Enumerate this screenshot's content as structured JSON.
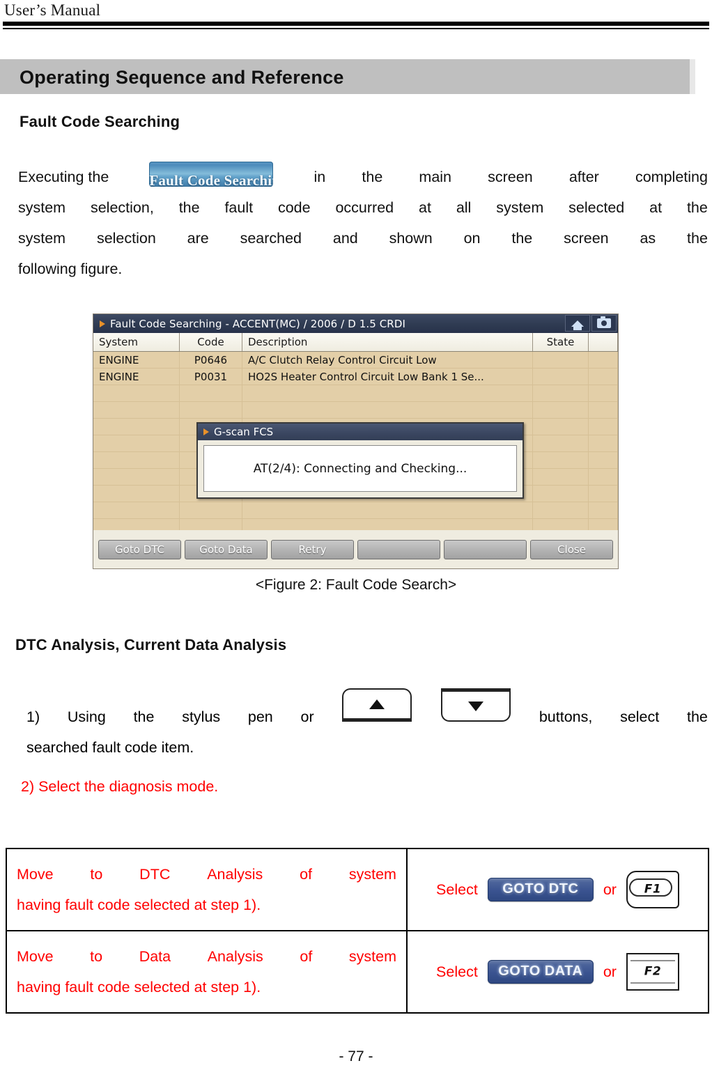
{
  "header": {
    "running_head": "User’s Manual",
    "section_banner_title": "Operating Sequence and Reference"
  },
  "sections": {
    "fault_code_searching_heading": "Fault Code Searching",
    "dtc_analysis_heading": "DTC Analysis, Current Data Analysis"
  },
  "intro_paragraph": {
    "line1_before": "Executing  the",
    "inline_button_label": "Fault Code Searching",
    "line1_words": [
      "in",
      "the",
      "main",
      "screen",
      "after",
      "completing"
    ],
    "line2_words": [
      "system",
      "selection,",
      "the",
      "fault",
      "code",
      "occurred",
      "at",
      "all",
      "system",
      "selected",
      "at",
      "the"
    ],
    "line3_words": [
      "system",
      "selection",
      "are",
      "searched",
      "and",
      "shown",
      "on",
      "the",
      "screen",
      "as",
      "the"
    ],
    "line4": "following figure."
  },
  "device_screenshot": {
    "title": "Fault Code Searching - ACCENT(MC) / 2006 / D 1.5 CRDI",
    "title_icons": [
      "home-icon",
      "camera-icon"
    ],
    "columns": [
      "System",
      "Code",
      "Description",
      "State",
      ""
    ],
    "rows": [
      {
        "system": "ENGINE",
        "code": "P0646",
        "description": "A/C Clutch Relay Control Circuit Low",
        "state": ""
      },
      {
        "system": "ENGINE",
        "code": "P0031",
        "description": "HO2S Heater Control Circuit Low Bank 1  Se...",
        "state": ""
      }
    ],
    "empty_row_count": 9,
    "modal": {
      "title": "G-scan FCS",
      "message": "AT(2/4): Connecting and Checking..."
    },
    "buttons": [
      "Goto DTC",
      "Goto Data",
      "Retry",
      "",
      "",
      "Close"
    ]
  },
  "figure_caption": "<Figure 2: Fault Code Search>",
  "step1": {
    "line1_words_a": [
      "1)",
      "Using",
      "the",
      "stylus",
      "pen",
      "or"
    ],
    "key_up": "up-arrow-key",
    "key_down": "down-arrow-key",
    "line1_words_b": [
      "buttons,",
      "select",
      "the"
    ],
    "line2": "searched fault code item."
  },
  "step2": {
    "text": "2) Select the diagnosis mode."
  },
  "mode_table": {
    "rows": [
      {
        "description_line1_words": [
          "Move",
          "to",
          "DTC",
          "Analysis",
          "of",
          "system"
        ],
        "description_line2": "having fault code selected at step 1).",
        "action_prefix": "Select",
        "action_button": "GOTO DTC",
        "action_or": "or",
        "action_key": "F1"
      },
      {
        "description_line1_words": [
          "Move",
          "to",
          "Data",
          "Analysis",
          "of",
          "system"
        ],
        "description_line2": "having fault code selected at step 1).",
        "action_prefix": "Select",
        "action_button": "GOTO DATA",
        "action_or": "or",
        "action_key": "F2"
      }
    ]
  },
  "footer": {
    "page_number": "- 77 -"
  },
  "colors": {
    "banner_gray": "#bfbfbf",
    "red_text": "#ff0000",
    "screenshot_titlebar": "#2f3b52",
    "table_row_tan": "#e3cfa8",
    "blue_button": "#3a5390"
  }
}
